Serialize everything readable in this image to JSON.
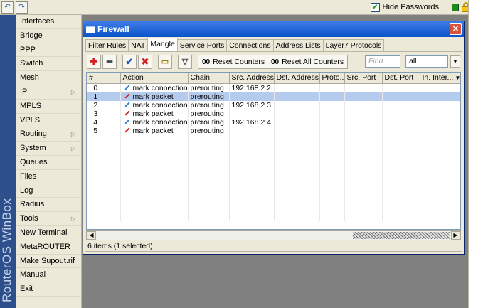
{
  "topbar": {
    "hide_passwords_label": "Hide Passwords",
    "hide_passwords_checked": true,
    "undo_icon": "undo-icon",
    "redo_icon": "redo-icon"
  },
  "brand": "RouterOS WinBox",
  "sidebar": {
    "items": [
      {
        "label": "Interfaces",
        "submenu": false
      },
      {
        "label": "Bridge",
        "submenu": false
      },
      {
        "label": "PPP",
        "submenu": false
      },
      {
        "label": "Switch",
        "submenu": false
      },
      {
        "label": "Mesh",
        "submenu": false
      },
      {
        "label": "IP",
        "submenu": true
      },
      {
        "label": "MPLS",
        "submenu": false
      },
      {
        "label": "VPLS",
        "submenu": false
      },
      {
        "label": "Routing",
        "submenu": true
      },
      {
        "label": "System",
        "submenu": true
      },
      {
        "label": "Queues",
        "submenu": false
      },
      {
        "label": "Files",
        "submenu": false
      },
      {
        "label": "Log",
        "submenu": false
      },
      {
        "label": "Radius",
        "submenu": false
      },
      {
        "label": "Tools",
        "submenu": true
      },
      {
        "label": "New Terminal",
        "submenu": false
      },
      {
        "label": "MetaROUTER",
        "submenu": false
      },
      {
        "label": "Make Supout.rif",
        "submenu": false
      },
      {
        "label": "Manual",
        "submenu": false
      },
      {
        "label": "Exit",
        "submenu": false
      }
    ]
  },
  "window": {
    "title": "Firewall",
    "tabs": [
      {
        "label": "Filter Rules",
        "active": false
      },
      {
        "label": "NAT",
        "active": false
      },
      {
        "label": "Mangle",
        "active": true
      },
      {
        "label": "Service Ports",
        "active": false
      },
      {
        "label": "Connections",
        "active": false
      },
      {
        "label": "Address Lists",
        "active": false
      },
      {
        "label": "Layer7 Protocols",
        "active": false
      }
    ],
    "toolbar": {
      "reset_counters": "Reset Counters",
      "reset_all_counters": "Reset All Counters",
      "counter_glyph": "00",
      "find_placeholder": "Find",
      "filter_value": "all"
    },
    "table": {
      "columns": [
        "#",
        "",
        "Action",
        "Chain",
        "Src. Address",
        "Dst. Address",
        "Proto...",
        "Src. Port",
        "Dst. Port",
        "In. Inter..."
      ],
      "rows": [
        {
          "num": "0",
          "action": "mark connection",
          "kind": "conn",
          "chain": "prerouting",
          "src": "192.168.2.2",
          "selected": false
        },
        {
          "num": "1",
          "action": "mark packet",
          "kind": "pkt",
          "chain": "prerouting",
          "src": "",
          "selected": true
        },
        {
          "num": "2",
          "action": "mark connection",
          "kind": "conn",
          "chain": "prerouting",
          "src": "192.168.2.3",
          "selected": false
        },
        {
          "num": "3",
          "action": "mark packet",
          "kind": "pkt",
          "chain": "prerouting",
          "src": "",
          "selected": false
        },
        {
          "num": "4",
          "action": "mark connection",
          "kind": "conn",
          "chain": "prerouting",
          "src": "192.168.2.4",
          "selected": false
        },
        {
          "num": "5",
          "action": "mark packet",
          "kind": "pkt",
          "chain": "prerouting",
          "src": "",
          "selected": false
        }
      ]
    },
    "status": "6 items (1 selected)"
  },
  "colors": {
    "titlebar": "#0a53c8",
    "selection": "#b5cbee",
    "brand_strip": "#2d4f8c",
    "workspace": "#808080"
  }
}
